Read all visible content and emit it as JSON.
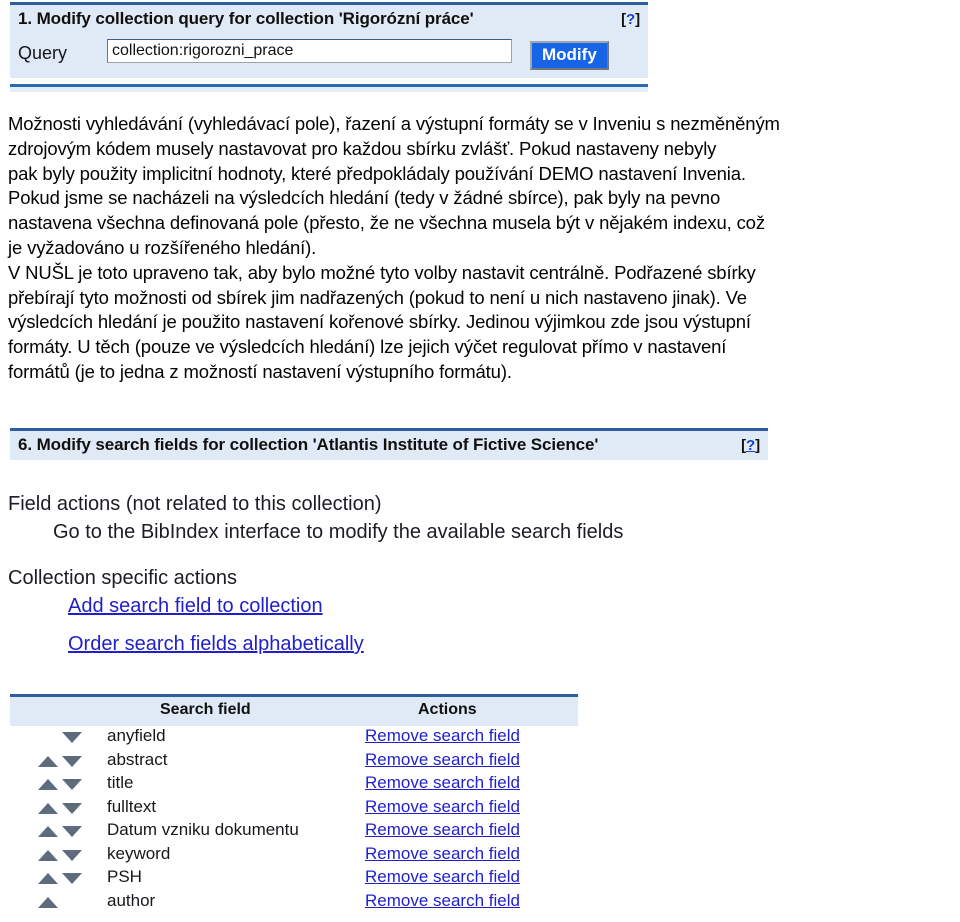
{
  "theme": {
    "rule_color": "#2a5e9e",
    "header_band": "#dfeaf6",
    "button_blue": "#1765e6",
    "link_blue": "#1f1fcc",
    "arrow_gray": "#5e6b7c"
  },
  "panel_one": {
    "title": "1. Modify collection query for collection 'Rigorózní práce'",
    "help_open": "[",
    "help_mark": "?",
    "help_close": "]",
    "query_label": "Query",
    "query_value": "collection:rigorozni_prace",
    "query_placeholder": "collection:...",
    "modify_label": "Modify"
  },
  "prose": {
    "lines": [
      "Možnosti vyhledávání (vyhledávací pole), řazení a výstupní formáty se v Inveniu s nezměněným",
      "zdrojovým kódem musely nastavovat pro každou sbírku zvlášť. Pokud nastaveny nebyly",
      "pak byly použity implicitní hodnoty, které předpokládaly používání DEMO nastavení Invenia.",
      "Pokud jsme se nacházeli na výsledcích hledání (tedy v žádné sbírce), pak byly na pevno",
      "nastavena všechna definovaná pole (přesto, že ne všechna musela být v nějakém indexu, což",
      "je vyžadováno u rozšířeného hledání).",
      "V NUŠL je toto upraveno tak, aby bylo možné tyto volby nastavit centrálně. Podřazené sbírky",
      "přebírají tyto možnosti od sbírek jim nadřazených (pokud to není u nich nastaveno jinak). Ve",
      "výsledcích hledání je použito nastavení kořenové sbírky. Jedinou výjimkou zde jsou výstupní",
      "formáty. U těch (pouze ve výsledcích hledání) lze jejich výčet regulovat přímo v nastavení",
      "formátů (je to jedna z možností nastavení výstupního formátu)."
    ]
  },
  "panel_two": {
    "title": "6. Modify search fields for collection 'Atlantis Institute of Fictive Science'",
    "help_open": "[",
    "help_mark": "?",
    "help_close": "]",
    "field_actions_heading": "Field actions (not related to this collection)",
    "field_actions_link": "Go to the BibIndex interface to modify the available search fields",
    "collection_actions_heading": "Collection specific actions",
    "add_field_link": "Add search field to collection",
    "order_fields_link": "Order search fields alphabetically"
  },
  "fields_table": {
    "columns": [
      "Search field",
      "Actions"
    ],
    "action_label": "Remove search field",
    "rows": [
      {
        "name": "anyfield",
        "up": false,
        "down": true
      },
      {
        "name": "abstract",
        "up": true,
        "down": true
      },
      {
        "name": "title",
        "up": true,
        "down": true
      },
      {
        "name": "fulltext",
        "up": true,
        "down": true
      },
      {
        "name": "Datum vzniku dokumentu",
        "up": true,
        "down": true
      },
      {
        "name": "keyword",
        "up": true,
        "down": true
      },
      {
        "name": "PSH",
        "up": true,
        "down": true
      },
      {
        "name": "author",
        "up": true,
        "down": false
      }
    ]
  }
}
